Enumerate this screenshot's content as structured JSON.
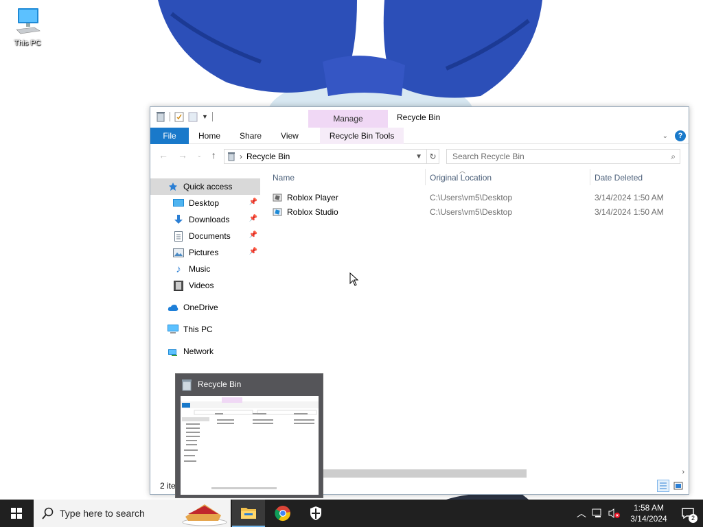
{
  "desktop": {
    "icons": [
      {
        "label": "This PC",
        "icon": "computer-icon"
      }
    ]
  },
  "window": {
    "title": "Recycle Bin",
    "contextual_tab_group": "Manage",
    "ribbon_tabs": [
      "File",
      "Home",
      "Share",
      "View",
      "Recycle Bin Tools"
    ],
    "address": "Recycle Bin",
    "search_placeholder": "Search Recycle Bin",
    "nav_pane": [
      {
        "label": "Quick access",
        "icon": "star-icon",
        "selected": true
      },
      {
        "label": "Desktop",
        "icon": "desktop-icon",
        "pinned": true
      },
      {
        "label": "Downloads",
        "icon": "download-arrow-icon",
        "pinned": true
      },
      {
        "label": "Documents",
        "icon": "document-icon",
        "pinned": true
      },
      {
        "label": "Pictures",
        "icon": "picture-icon",
        "pinned": true
      },
      {
        "label": "Music",
        "icon": "music-note-icon"
      },
      {
        "label": "Videos",
        "icon": "film-icon"
      },
      {
        "label": "OneDrive",
        "icon": "cloud-icon"
      },
      {
        "label": "This PC",
        "icon": "computer-icon"
      },
      {
        "label": "Network",
        "icon": "network-icon"
      }
    ],
    "columns": [
      "Name",
      "Original Location",
      "Date Deleted"
    ],
    "files": [
      {
        "name": "Roblox Player",
        "location": "C:\\Users\\vm5\\Desktop",
        "date": "3/14/2024 1:50 AM",
        "icon": "roblox-player-icon"
      },
      {
        "name": "Roblox Studio",
        "location": "C:\\Users\\vm5\\Desktop",
        "date": "3/14/2024 1:50 AM",
        "icon": "roblox-studio-icon"
      }
    ],
    "status": "2 ite"
  },
  "thumbnail": {
    "title": "Recycle Bin"
  },
  "taskbar": {
    "search_placeholder": "Type here to search",
    "apps": [
      "file-explorer-icon",
      "chrome-icon",
      "security-shield-icon"
    ],
    "time": "1:58 AM",
    "date": "3/14/2024",
    "notification_count": "2"
  }
}
